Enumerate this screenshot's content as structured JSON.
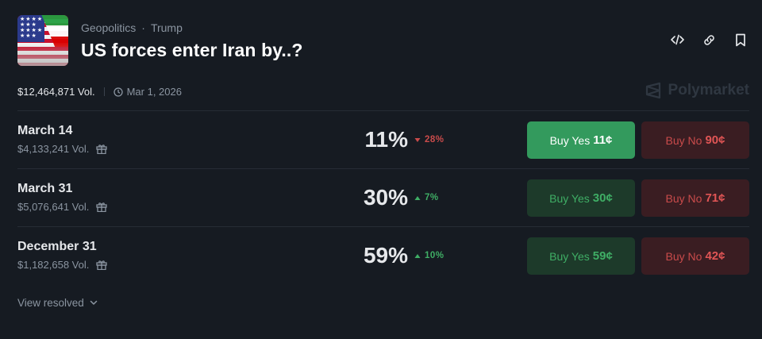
{
  "header": {
    "breadcrumb": [
      "Geopolitics",
      "Trump"
    ],
    "separator": "·",
    "title": "US forces enter Iran by..?"
  },
  "actions": [
    {
      "icon": "embed-code-icon"
    },
    {
      "icon": "link-icon"
    },
    {
      "icon": "bookmark-icon"
    }
  ],
  "meta": {
    "volume": "$12,464,871 Vol.",
    "date": "Mar 1, 2026"
  },
  "brand": {
    "name": "Polymarket"
  },
  "markets": [
    {
      "label": "March 14",
      "volume": "$4,133,241 Vol.",
      "percent": "11%",
      "change": "28%",
      "direction": "down",
      "yes_label": "Buy Yes",
      "yes_price": "11¢",
      "no_label": "Buy No",
      "no_price": "90¢"
    },
    {
      "label": "March 31",
      "volume": "$5,076,641 Vol.",
      "percent": "30%",
      "change": "7%",
      "direction": "up",
      "yes_label": "Buy Yes",
      "yes_price": "30¢",
      "no_label": "Buy No",
      "no_price": "71¢"
    },
    {
      "label": "December 31",
      "volume": "$1,182,658 Vol.",
      "percent": "59%",
      "change": "10%",
      "direction": "up",
      "yes_label": "Buy Yes",
      "yes_price": "59¢",
      "no_label": "Buy No",
      "no_price": "42¢"
    }
  ],
  "footer": {
    "view_resolved": "View resolved"
  },
  "colors": {
    "background": "#161b22",
    "yes_active": "#339a5d",
    "yes_muted": "#1d3a2a",
    "no": "#3a1d22",
    "up": "#3fae65",
    "down": "#c94b4b"
  }
}
